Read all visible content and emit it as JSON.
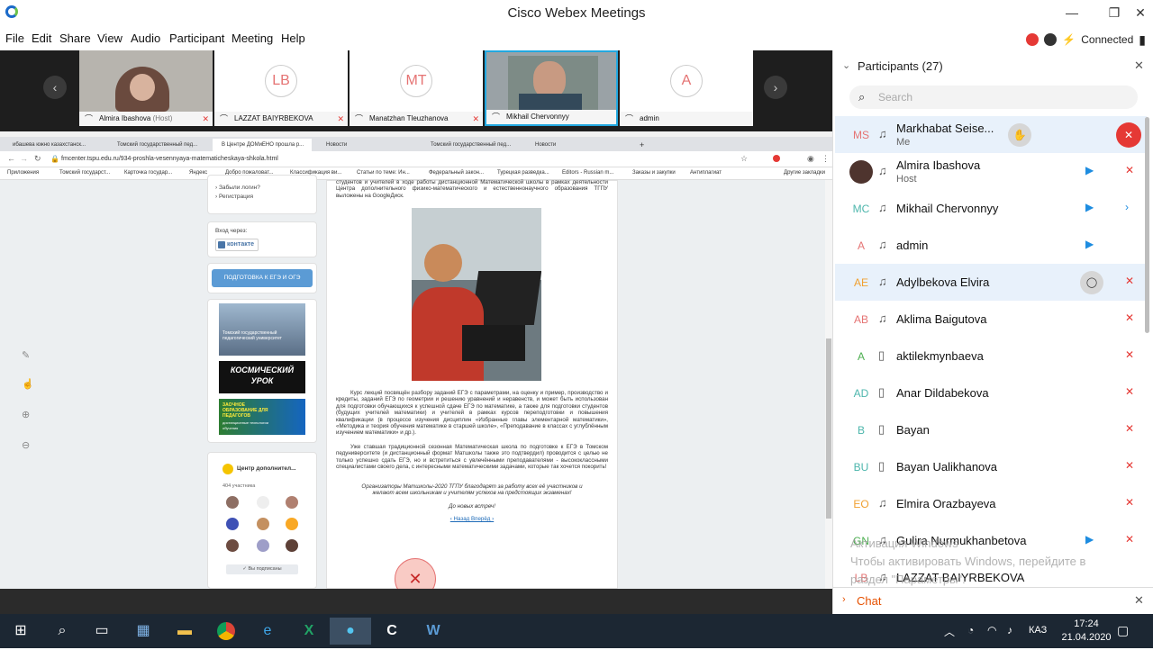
{
  "window": {
    "title": "Cisco Webex Meetings",
    "minimize": "—",
    "maximize": "❐",
    "close": "✕"
  },
  "menu": [
    "File",
    "Edit",
    "Share",
    "View",
    "Audio",
    "Participant",
    "Meeting",
    "Help"
  ],
  "connection": {
    "status": "Connected"
  },
  "filmstrip": {
    "tiles": [
      {
        "initials": "",
        "name": "Almira Ibashova",
        "suffix": "(Host)"
      },
      {
        "initials": "LB",
        "name": "LAZZAT BAIYRBEKOVA"
      },
      {
        "initials": "MT",
        "name": "Manatzhan Tleuzhanova"
      },
      {
        "initials": "",
        "name": "Mikhail Chervonnyy"
      },
      {
        "initials": "A",
        "name": "admin"
      }
    ],
    "prev": "‹",
    "next": "›"
  },
  "browser": {
    "tabs": [
      "ибашева южно казахстанск...",
      "Томский государственный пед...",
      "В Центре ДОМиЕНО прошла р...",
      "Новости",
      "Томский государственный пед...",
      "Новости"
    ],
    "new_tab": "+",
    "url": "fmcenter.tspu.edu.ru/934-proshla-vesennyaya-matematicheskaya-shkola.html",
    "bookmarks": [
      "Приложения",
      "Томский государст...",
      "Карточка государ...",
      "Яндекс",
      "Добро пожаловат...",
      "Классификация ви...",
      "Статьи по теме: Ин...",
      "Федеральный закон...",
      "Турецкая разведка...",
      "Editors - Russian m...",
      "Заказы и закупки",
      "Антиплагиат",
      "Другие закладки"
    ]
  },
  "site": {
    "login_links": [
      "› Забыли логин?",
      "› Регистрация"
    ],
    "login_via": "Вход через:",
    "vk_button": "контакте",
    "ege_button": "ПОДГОТОВКА К ЕГЭ И ОГЭ",
    "banner1": "Томский государственный педагогический университет",
    "banner2": "КОСМИЧЕСКИЙ УРОК",
    "banner3": "ЗАОЧНОЕ ОБРАЗОВАНИЕ ДЛЯ ПЕДАГОГОВ",
    "banner3_sub": "дистанционные технологии обучения",
    "group_name": "Центр дополнител...",
    "group_members": "404 участника",
    "subscribed": "✓ Вы подписаны",
    "article_intro": "студентов и учителей в ходе работы дистанционной Математической школы в рамках деятельности Центра дополнительного физико-математического и естественнонаучного образования ТГПУ выложены на GoogleДиск.",
    "article_p1": "Курс лекций посвящён разбору заданий ЕГЭ с параметрами, на оценку и пример, производство и кредиты, заданий ЕГЭ по геометрии и решению уравнений и неравенств, и может быть использован для подготовки обучающихся к успешной сдаче ЕГЭ по математике, а также для подготовки студентов (будущих учителей математики) и учителей в рамках курсов переподготовки и повышения квалификации (в процессе изучения дисциплин «Избранные главы элементарной математики», «Методика и теория обучения математике в старшей школе», «Преподавание в классах с углублённым изучением математики» и др.).",
    "article_p2": "Уже ставшая традиционной сезонная Математическая школа по подготовке к ЕГЭ в Томском педуниверситете (и дистанционный формат Матшколы также это подтвердил) проводится с целью не только успешно сдать ЕГЭ, но и встретиться с увлечёнными преподавателями - высококлассными специалистами своего дела, с интересными математическими задачами, которые так хочется покорить!",
    "article_p3": "Организаторы Матшколы-2020 ТГПУ благодарят за работу всех её участников и желают всем школьникам и учителям успехов на предстоящих экзаменах!",
    "article_p4": "До новых встреч!",
    "nav": "‹ Назад  Вперёд ›"
  },
  "panel": {
    "title": "Participants (27)",
    "search_placeholder": "Search",
    "participants": [
      {
        "initials": "MS",
        "name": "Markhabat Seise...",
        "sub": "Me",
        "color": "#e57373"
      },
      {
        "initials": "",
        "name": "Almira Ibashova",
        "sub": "Host",
        "color": "#555"
      },
      {
        "initials": "MC",
        "name": "Mikhail Chervonnyy",
        "sub": "",
        "color": "#4db6ac"
      },
      {
        "initials": "A",
        "name": "admin",
        "sub": "",
        "color": "#e57373"
      },
      {
        "initials": "AE",
        "name": "Adylbekova Elvira",
        "sub": "",
        "color": "#f0a030"
      },
      {
        "initials": "AB",
        "name": "Aklima Baigutova",
        "sub": "",
        "color": "#e57373"
      },
      {
        "initials": "A",
        "name": "aktilekmynbaeva",
        "sub": "",
        "color": "#4caf50"
      },
      {
        "initials": "AD",
        "name": "Anar Dildabekova",
        "sub": "",
        "color": "#4db6ac"
      },
      {
        "initials": "B",
        "name": "Bayan",
        "sub": "",
        "color": "#4db6ac"
      },
      {
        "initials": "BU",
        "name": "Bayan Ualikhanova",
        "sub": "",
        "color": "#4db6ac"
      },
      {
        "initials": "EO",
        "name": "Elmira Orazbayeva",
        "sub": "",
        "color": "#f0a030"
      },
      {
        "initials": "GN",
        "name": "Gulira Nurmukhanbetova",
        "sub": "",
        "color": "#4caf50"
      },
      {
        "initials": "LB",
        "name": "LAZZAT BAIYRBEKOVA",
        "sub": "",
        "color": "#e57373"
      }
    ],
    "chat": "Chat",
    "close": "✕"
  },
  "watermark": {
    "line1": "Активация Windows",
    "line2": "Чтобы активировать Windows, перейдите в",
    "line3": "раздел \"Параметры\"."
  },
  "taskbar": {
    "time": "17:24",
    "date": "21.04.2020",
    "lang": "КАЗ"
  }
}
